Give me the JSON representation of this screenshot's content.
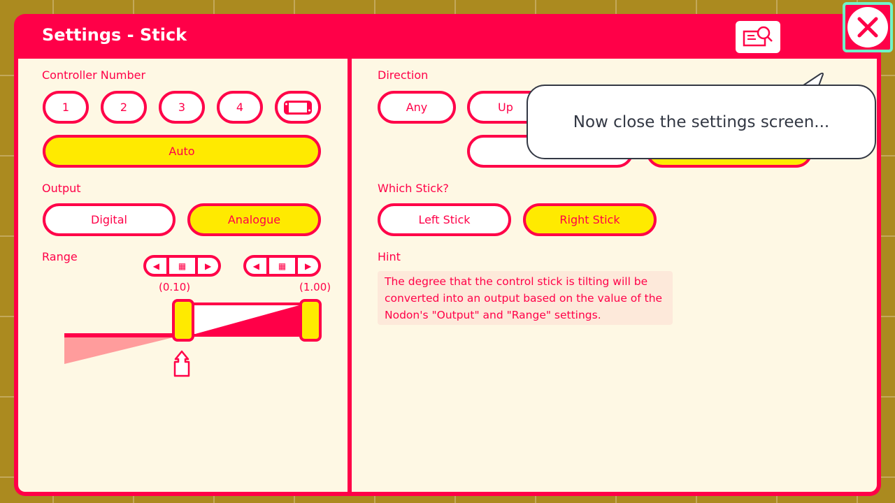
{
  "dialog": {
    "title": "Settings - Stick",
    "help_icon": "manual-search-icon",
    "close_icon": "close-x-icon"
  },
  "controller": {
    "label": "Controller Number",
    "numbers": [
      "1",
      "2",
      "3",
      "4"
    ],
    "handheld_icon": "handheld-console-icon",
    "auto": "Auto",
    "selected": "Auto"
  },
  "output": {
    "label": "Output",
    "options": [
      "Digital",
      "Analogue"
    ],
    "selected": "Analogue"
  },
  "range": {
    "label": "Range",
    "min_value": "(0.10)",
    "max_value": "(1.00)",
    "min": 0.1,
    "max": 1.0
  },
  "direction": {
    "label": "Direction",
    "options": [
      "Any",
      "Up",
      "Up"
    ]
  },
  "which_stick": {
    "label": "Which Stick?",
    "options": [
      "Left Stick",
      "Right Stick"
    ],
    "selected": "Right Stick"
  },
  "hint": {
    "label": "Hint",
    "text": "The degree that the control stick is tilting will be converted into an output based on the value of the Nodon's \"Output\" and \"Range\" settings."
  },
  "tutorial": {
    "message": "Now close the settings screen..."
  },
  "colors": {
    "accent": "#ff0048",
    "selected": "#ffea00",
    "panel": "#fef8e4",
    "highlight": "#6ff5c8"
  }
}
